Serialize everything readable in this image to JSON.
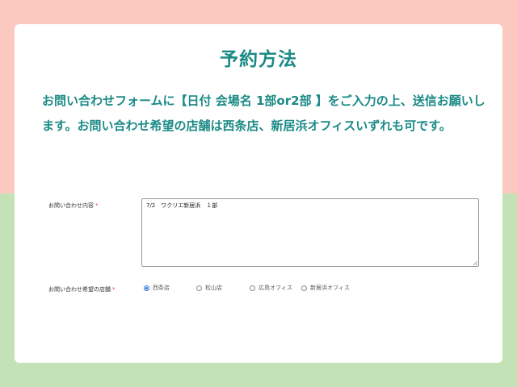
{
  "page": {
    "title": "予約方法",
    "description": "お問い合わせフォームに【日付 会場名 1部or2部 】をご入力の上、送信お願いします。お問い合わせ希望の店舗は西条店、新居浜オフィスいずれも可です。"
  },
  "form": {
    "inquiry_label": "お問い合わせ内容",
    "required_mark": "*",
    "inquiry_value": "7/2　ワクリエ新居浜　１部",
    "store_label": "お問い合わせ希望の店舗",
    "store_options": [
      {
        "label": "西条店",
        "checked": true
      },
      {
        "label": "松山店",
        "checked": false
      },
      {
        "label": "広島オフィス",
        "checked": false
      },
      {
        "label": "新居浜オフィス",
        "checked": false
      }
    ]
  },
  "colors": {
    "heading_teal": "#1b8a86",
    "bg_top_pink": "#fcc9c1",
    "bg_bottom_green": "#c3e3b7",
    "required_red": "#e14b4b",
    "radio_checked_blue": "#2a6fd6"
  }
}
